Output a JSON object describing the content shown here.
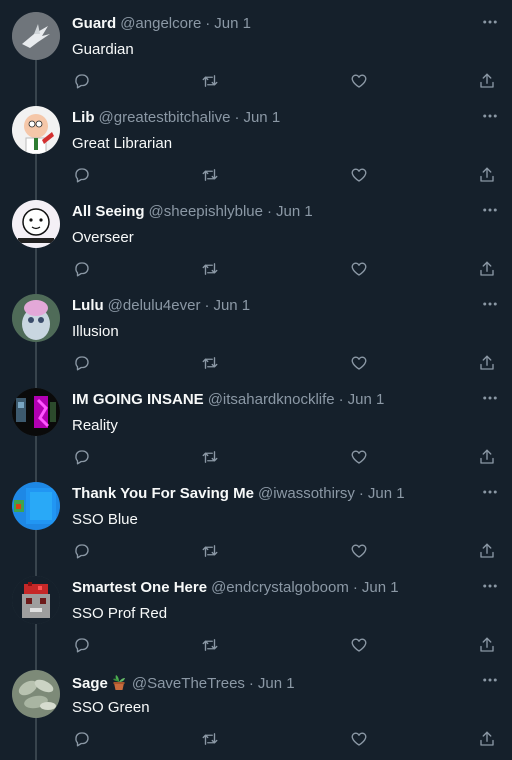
{
  "colors": {
    "background": "#15202b",
    "text": "#f7f9f9",
    "muted": "#8b98a5",
    "line": "#38444d"
  },
  "icons": {
    "reply": "reply-icon",
    "retweet": "retweet-icon",
    "like": "heart-icon",
    "share": "share-icon",
    "more": "more-icon"
  },
  "tweets": [
    {
      "name": "Guard",
      "handle": "@angelcore",
      "dot": "·",
      "date": "Jun 1",
      "text": "Guardian"
    },
    {
      "name": "Lib",
      "handle": "@greatestbitchalive",
      "dot": "·",
      "date": "Jun 1",
      "text": "Great Librarian"
    },
    {
      "name": "All Seeing",
      "handle": "@sheepishlyblue",
      "dot": "·",
      "date": "Jun 1",
      "text": "Overseer"
    },
    {
      "name": "Lulu",
      "handle": "@delulu4ever",
      "dot": "·",
      "date": "Jun 1",
      "text": "Illusion"
    },
    {
      "name": "IM GOING INSANE",
      "handle": "@itsahardknocklife",
      "dot": "·",
      "date": "Jun 1",
      "text": "Reality"
    },
    {
      "name": "Thank You For Saving Me",
      "handle": "@iwassothirsy",
      "dot": "·",
      "date": "Jun 1",
      "text": "SSO Blue"
    },
    {
      "name": "Smartest One Here",
      "handle": "@endcrystalgoboom",
      "dot": "·",
      "date": "Jun 1",
      "text": "SSO Prof Red"
    },
    {
      "name": "Sage",
      "handle": "@SaveTheTrees",
      "dot": "·",
      "date": "Jun 1",
      "text": "SSO Green"
    }
  ]
}
